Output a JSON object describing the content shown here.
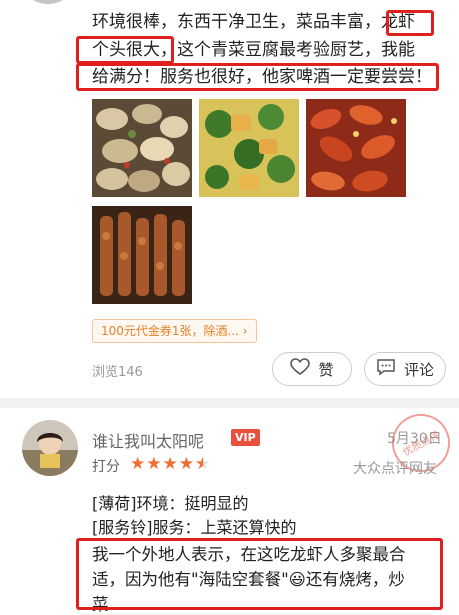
{
  "review1": {
    "lines": [
      "环境很棒，东西干净卫生，菜品丰富，龙虾",
      "个头很大，这个青菜豆腐最考验厨艺，我能",
      "给满分！服务也很好，他家啤酒一定要尝尝！"
    ],
    "coupon": "100元代金券1张，除酒... ›",
    "views": "浏览146",
    "like_label": "赞",
    "comment_label": "评论"
  },
  "review2": {
    "username": "谁让我叫太阳呢",
    "vip_badge": "VIP",
    "date": "5月30日",
    "score_label": "打分",
    "rating": 4.5,
    "stars": "★★★★★",
    "source": "大众点评网友",
    "stamp_text": "优质点评",
    "lines": [
      "[薄荷]环境：挺明显的",
      "[服务铃]服务：上菜还算快的",
      "我一个外地人表示，在这吃龙虾人多聚最合",
      "适，因为他有\"海陆空套餐\"😃还有烧烤，炒",
      "菜"
    ]
  },
  "colors": {
    "highlight": "#e0201f",
    "star": "#f06d2f",
    "vip": "#e9503e",
    "coupon": "#e6802a"
  },
  "icons": [
    "heart-icon",
    "comment-icon"
  ]
}
